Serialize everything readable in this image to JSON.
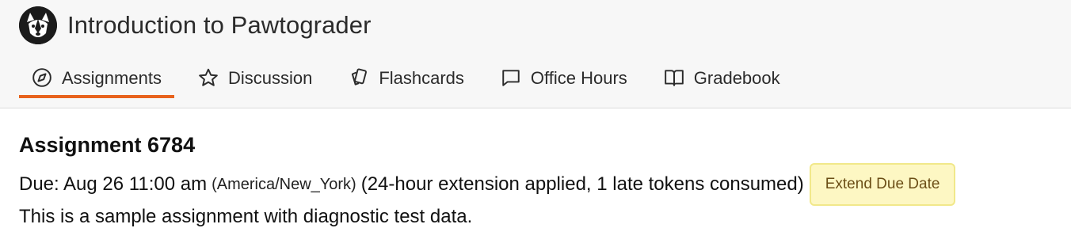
{
  "header": {
    "course_title": "Introduction to Pawtograder",
    "logo_icon": "husky-logo-icon",
    "accent_color": "#e8621c"
  },
  "tabs": [
    {
      "label": "Assignments",
      "icon": "compass-icon",
      "active": true
    },
    {
      "label": "Discussion",
      "icon": "star-icon",
      "active": false
    },
    {
      "label": "Flashcards",
      "icon": "cards-icon",
      "active": false
    },
    {
      "label": "Office Hours",
      "icon": "chat-bubble-icon",
      "active": false
    },
    {
      "label": "Gradebook",
      "icon": "book-open-icon",
      "active": false
    }
  ],
  "assignment": {
    "title": "Assignment 6784",
    "due_label": "Due: Aug 26 11:00 am",
    "timezone": "(America/New_York)",
    "extension_note": "(24-hour extension applied, 1 late tokens consumed)",
    "extend_button_label": "Extend Due Date",
    "description_partial": "This is a sample assignment with diagnostic test data."
  }
}
